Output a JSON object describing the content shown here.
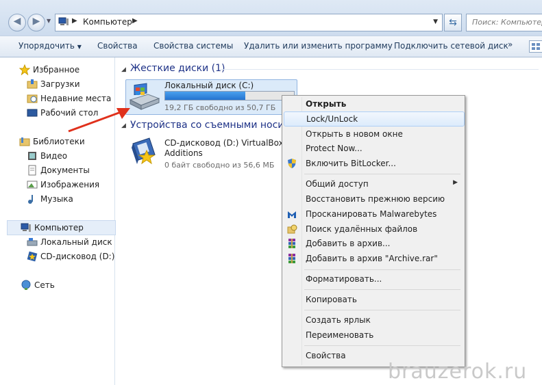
{
  "address": {
    "path": "Компьютер",
    "search_placeholder": "Поиск: Компьютер"
  },
  "toolbar": {
    "organize": "Упорядочить",
    "properties": "Свойства",
    "system_properties": "Свойства системы",
    "uninstall": "Удалить или изменить программу",
    "map_drive": "Подключить сетевой диск",
    "more": "»"
  },
  "sidebar": {
    "favorites": "Избранное",
    "downloads": "Загрузки",
    "recent": "Недавние места",
    "desktop": "Рабочий стол",
    "libraries": "Библиотеки",
    "video": "Видео",
    "documents": "Документы",
    "images": "Изображения",
    "music": "Музыка",
    "computer": "Компьютер",
    "local_disk": "Локальный диск (C",
    "cd_drive": "CD-дисковод (D:) Vi",
    "network": "Сеть"
  },
  "content": {
    "hard_disks_group": "Жесткие диски (1)",
    "drive_c_name": "Локальный диск (C:)",
    "drive_c_free": "19,2 ГБ свободно из 50,7 ГБ",
    "drive_c_used_fraction": 0.62,
    "removable_group": "Устройства со съемными носит",
    "cd_name": "CD-дисковод (D:) VirtualBox Gue",
    "cd_name2": "Additions",
    "cd_free": "0 байт свободно из 56,6 МБ"
  },
  "context_menu": {
    "open": "Открыть",
    "lock": "Lock/UnLock",
    "open_new_window": "Открыть в новом окне",
    "protect": "Protect Now...",
    "bitlocker": "Включить BitLocker...",
    "share": "Общий доступ",
    "restore": "Восстановить прежнюю версию",
    "malwarebytes": "Просканировать Malwarebytes",
    "search_deleted": "Поиск удалённых файлов",
    "add_archive": "Добавить в архив...",
    "add_archive_rar": "Добавить в архив \"Archive.rar\"",
    "format": "Форматировать...",
    "copy": "Копировать",
    "create_shortcut": "Создать ярлык",
    "rename": "Переименовать",
    "properties": "Свойства"
  },
  "watermark": "brauzerok.ru",
  "colors": {
    "highlight": "#f7f727",
    "arrow": "#e0311c",
    "selection": "#dbeaf9"
  }
}
